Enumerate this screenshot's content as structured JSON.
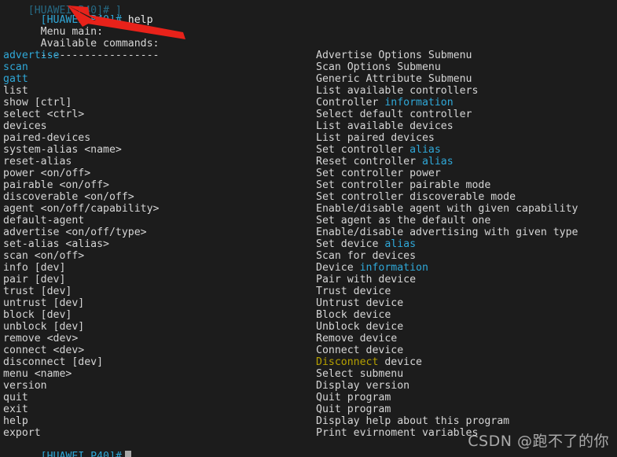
{
  "terminal": {
    "background_color": "#1c1c1c",
    "foreground_color": "#d6d6d6",
    "accent_cyan": "#2fa8d8",
    "accent_yellow": "#b5a000",
    "annotation_color": "#e8221a",
    "clipped_top_line": "[HUAWEI P40]# ]",
    "command_line": {
      "prompt": "[HUAWEI P40]#",
      "typed_command": " help"
    },
    "header_lines": [
      "Menu main:",
      "Available commands:",
      "-------------------"
    ],
    "entries": [
      {
        "cmd": "advertise",
        "cmd_color": "cyan",
        "desc_pre": "Advertise Options Submenu",
        "desc_hl": "",
        "desc_post": ""
      },
      {
        "cmd": "scan",
        "cmd_color": "cyan",
        "desc_pre": "Scan Options Submenu",
        "desc_hl": "",
        "desc_post": ""
      },
      {
        "cmd": "gatt",
        "cmd_color": "cyan",
        "desc_pre": "Generic Attribute Submenu",
        "desc_hl": "",
        "desc_post": ""
      },
      {
        "cmd": "list",
        "cmd_color": "default",
        "desc_pre": "List available controllers",
        "desc_hl": "",
        "desc_post": ""
      },
      {
        "cmd": "show [ctrl]",
        "cmd_color": "default",
        "desc_pre": "Controller ",
        "desc_hl": "information",
        "desc_post": ""
      },
      {
        "cmd": "select <ctrl>",
        "cmd_color": "default",
        "desc_pre": "Select default controller",
        "desc_hl": "",
        "desc_post": ""
      },
      {
        "cmd": "devices",
        "cmd_color": "default",
        "desc_pre": "List available devices",
        "desc_hl": "",
        "desc_post": ""
      },
      {
        "cmd": "paired-devices",
        "cmd_color": "default",
        "desc_pre": "List paired devices",
        "desc_hl": "",
        "desc_post": ""
      },
      {
        "cmd": "system-alias <name>",
        "cmd_color": "default",
        "desc_pre": "Set controller ",
        "desc_hl": "alias",
        "desc_post": ""
      },
      {
        "cmd": "reset-alias",
        "cmd_color": "default",
        "desc_pre": "Reset controller ",
        "desc_hl": "alias",
        "desc_post": ""
      },
      {
        "cmd": "power <on/off>",
        "cmd_color": "default",
        "desc_pre": "Set controller power",
        "desc_hl": "",
        "desc_post": ""
      },
      {
        "cmd": "pairable <on/off>",
        "cmd_color": "default",
        "desc_pre": "Set controller pairable mode",
        "desc_hl": "",
        "desc_post": ""
      },
      {
        "cmd": "discoverable <on/off>",
        "cmd_color": "default",
        "desc_pre": "Set controller discoverable mode",
        "desc_hl": "",
        "desc_post": ""
      },
      {
        "cmd": "agent <on/off/capability>",
        "cmd_color": "default",
        "desc_pre": "Enable/disable agent with given capability",
        "desc_hl": "",
        "desc_post": ""
      },
      {
        "cmd": "default-agent",
        "cmd_color": "default",
        "desc_pre": "Set agent as the default one",
        "desc_hl": "",
        "desc_post": ""
      },
      {
        "cmd": "advertise <on/off/type>",
        "cmd_color": "default",
        "desc_pre": "Enable/disable advertising with given type",
        "desc_hl": "",
        "desc_post": ""
      },
      {
        "cmd": "set-alias <alias>",
        "cmd_color": "default",
        "desc_pre": "Set device ",
        "desc_hl": "alias",
        "desc_post": ""
      },
      {
        "cmd": "scan <on/off>",
        "cmd_color": "default",
        "desc_pre": "Scan for devices",
        "desc_hl": "",
        "desc_post": ""
      },
      {
        "cmd": "info [dev]",
        "cmd_color": "default",
        "desc_pre": "Device ",
        "desc_hl": "information",
        "desc_post": ""
      },
      {
        "cmd": "pair [dev]",
        "cmd_color": "default",
        "desc_pre": "Pair with device",
        "desc_hl": "",
        "desc_post": ""
      },
      {
        "cmd": "trust [dev]",
        "cmd_color": "default",
        "desc_pre": "Trust device",
        "desc_hl": "",
        "desc_post": ""
      },
      {
        "cmd": "untrust [dev]",
        "cmd_color": "default",
        "desc_pre": "Untrust device",
        "desc_hl": "",
        "desc_post": ""
      },
      {
        "cmd": "block [dev]",
        "cmd_color": "default",
        "desc_pre": "Block device",
        "desc_hl": "",
        "desc_post": ""
      },
      {
        "cmd": "unblock [dev]",
        "cmd_color": "default",
        "desc_pre": "Unblock device",
        "desc_hl": "",
        "desc_post": ""
      },
      {
        "cmd": "remove <dev>",
        "cmd_color": "default",
        "desc_pre": "Remove device",
        "desc_hl": "",
        "desc_post": ""
      },
      {
        "cmd": "connect <dev>",
        "cmd_color": "default",
        "desc_pre": "Connect device",
        "desc_hl": "",
        "desc_post": ""
      },
      {
        "cmd": "disconnect [dev]",
        "cmd_color": "default",
        "desc_pre": "",
        "desc_hl_yellow": "Disconnect",
        "desc_post": " device"
      },
      {
        "cmd": "menu <name>",
        "cmd_color": "default",
        "desc_pre": "Select submenu",
        "desc_hl": "",
        "desc_post": ""
      },
      {
        "cmd": "version",
        "cmd_color": "default",
        "desc_pre": "Display version",
        "desc_hl": "",
        "desc_post": ""
      },
      {
        "cmd": "quit",
        "cmd_color": "default",
        "desc_pre": "Quit program",
        "desc_hl": "",
        "desc_post": ""
      },
      {
        "cmd": "exit",
        "cmd_color": "default",
        "desc_pre": "Quit program",
        "desc_hl": "",
        "desc_post": ""
      },
      {
        "cmd": "help",
        "cmd_color": "default",
        "desc_pre": "Display help about this program",
        "desc_hl": "",
        "desc_post": ""
      },
      {
        "cmd": "export",
        "cmd_color": "default",
        "desc_pre": "Print evirnoment variables",
        "desc_hl": "",
        "desc_post": ""
      }
    ]
  },
  "watermark": {
    "text": "CSDN @跑不了的你"
  }
}
